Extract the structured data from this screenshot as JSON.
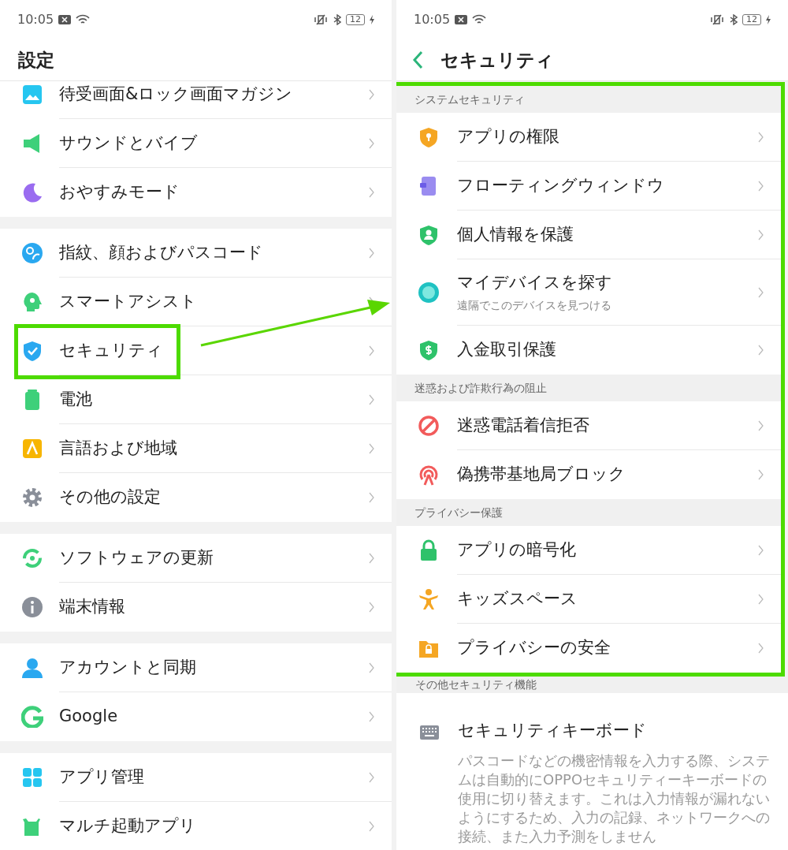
{
  "panels": [
    {
      "status_bar": {
        "time": "10:05",
        "battery": "12"
      },
      "header": {
        "title": "設定",
        "back": false
      },
      "sections": [
        {
          "framed": false,
          "items": [
            {
              "kind": "nav",
              "label": "待受画面&ロック画面マガジン",
              "highlighted": false
            },
            {
              "kind": "nav",
              "label": "サウンドとバイブ",
              "highlighted": false
            },
            {
              "kind": "nav",
              "label": "おやすみモード",
              "highlighted": false
            }
          ]
        },
        {
          "framed": false,
          "items": [
            {
              "kind": "nav",
              "label": "指紋、顔およびパスコード",
              "highlighted": false
            },
            {
              "kind": "nav",
              "label": "スマートアシスト",
              "highlighted": false
            },
            {
              "kind": "nav",
              "label": "セキュリティ",
              "highlighted": true
            },
            {
              "kind": "nav",
              "label": "電池",
              "highlighted": false
            },
            {
              "kind": "nav",
              "label": "言語および地域",
              "highlighted": false
            },
            {
              "kind": "nav",
              "label": "その他の設定",
              "highlighted": false
            }
          ]
        },
        {
          "framed": false,
          "items": [
            {
              "kind": "nav",
              "label": "ソフトウェアの更新",
              "highlighted": false
            },
            {
              "kind": "nav",
              "label": "端末情報",
              "highlighted": false
            }
          ]
        },
        {
          "framed": false,
          "items": [
            {
              "kind": "nav",
              "label": "アカウントと同期",
              "highlighted": false
            },
            {
              "kind": "nav",
              "label": "Google",
              "highlighted": false
            }
          ]
        },
        {
          "framed": false,
          "items": [
            {
              "kind": "nav",
              "label": "アプリ管理",
              "highlighted": false
            },
            {
              "kind": "nav",
              "label": "マルチ起動アプリ",
              "highlighted": false
            }
          ]
        }
      ]
    },
    {
      "status_bar": {
        "time": "10:05",
        "battery": "12"
      },
      "header": {
        "title": "セキュリティ",
        "back": true
      },
      "sections": [
        {
          "framed": true,
          "heading": "システムセキュリティ",
          "items": [
            {
              "kind": "nav",
              "label": "アプリの権限",
              "highlighted": false
            },
            {
              "kind": "nav",
              "label": "フローティングウィンドウ",
              "highlighted": false
            },
            {
              "kind": "nav",
              "label": "個人情報を保護",
              "highlighted": false
            },
            {
              "kind": "nav",
              "label": "マイデバイスを探す",
              "subtitle": "遠隔でこのデバイスを見つける",
              "highlighted": false
            },
            {
              "kind": "nav",
              "label": "入金取引保護",
              "highlighted": false
            }
          ]
        },
        {
          "framed": true,
          "heading": "迷惑および詐欺行為の阻止",
          "items": [
            {
              "kind": "nav",
              "label": "迷惑電話着信拒否",
              "highlighted": false
            },
            {
              "kind": "nav",
              "label": "偽携帯基地局ブロック",
              "highlighted": false
            }
          ]
        },
        {
          "framed": true,
          "heading": "プライバシー保護",
          "items": [
            {
              "kind": "nav",
              "label": "アプリの暗号化",
              "highlighted": false
            },
            {
              "kind": "nav",
              "label": "キッズスペース",
              "highlighted": false
            },
            {
              "kind": "nav",
              "label": "プライバシーの安全",
              "highlighted": false
            }
          ]
        },
        {
          "framed": false,
          "heading": "その他セキュリティ機能",
          "items": [
            {
              "kind": "note",
              "label": "セキュリティキーボード",
              "subtitle": "パスコードなどの機密情報を入力する際、システムは自動的にOPPOセキュリティーキーボードの使用に切り替えます。これは入力情報が漏れないようにするため、入力の記録、ネットワークへの接続、また入力予測をしません",
              "highlighted": false
            }
          ]
        }
      ]
    }
  ]
}
